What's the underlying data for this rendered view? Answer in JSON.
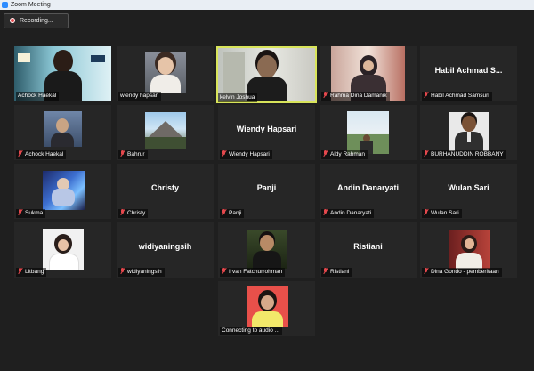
{
  "window": {
    "title": "Zoom Meeting"
  },
  "recording": {
    "label": "Recording..."
  },
  "participants": [
    {
      "name": "Achock Haekal",
      "muted": false,
      "video": true
    },
    {
      "name": "wiendy hapsari",
      "muted": false,
      "video": true
    },
    {
      "name": "kelvin Joshua",
      "muted": false,
      "video": true,
      "speaking": true
    },
    {
      "name": "Rahma Dina Damanik",
      "muted": true,
      "video": true
    },
    {
      "name": "Habil Achmad Samsuri",
      "muted": true,
      "video": false,
      "display_name": "Habil  Achmad  S..."
    },
    {
      "name": "Achock Haekal",
      "muted": true,
      "video": true
    },
    {
      "name": "Bahrur",
      "muted": true,
      "video": true
    },
    {
      "name": "Wiendy Hapsari",
      "muted": true,
      "video": false,
      "display_name": "Wiendy Hapsari"
    },
    {
      "name": "Aldy Rahman",
      "muted": true,
      "video": true
    },
    {
      "name": "BURHANUDDIN ROBBANY",
      "muted": true,
      "video": true
    },
    {
      "name": "Sukma",
      "muted": true,
      "video": true
    },
    {
      "name": "Christy",
      "muted": true,
      "video": false,
      "display_name": "Christy"
    },
    {
      "name": "Panji",
      "muted": true,
      "video": false,
      "display_name": "Panji"
    },
    {
      "name": "Andin Danaryati",
      "muted": true,
      "video": false,
      "display_name": "Andin Danaryati"
    },
    {
      "name": "Wulan Sari",
      "muted": true,
      "video": false,
      "display_name": "Wulan Sari"
    },
    {
      "name": "Litbang",
      "muted": true,
      "video": true
    },
    {
      "name": "widiyaningsih",
      "muted": true,
      "video": false,
      "display_name": "widiyaningsih"
    },
    {
      "name": "Irvan Fatchurrohman",
      "muted": true,
      "video": true
    },
    {
      "name": "Ristiani",
      "muted": true,
      "video": false,
      "display_name": "Ristiani"
    },
    {
      "name": "Dina Gondo - pemberitaan",
      "muted": true,
      "video": true
    },
    {
      "name": "Connecting to audio ...",
      "muted": false,
      "video": true
    }
  ]
}
